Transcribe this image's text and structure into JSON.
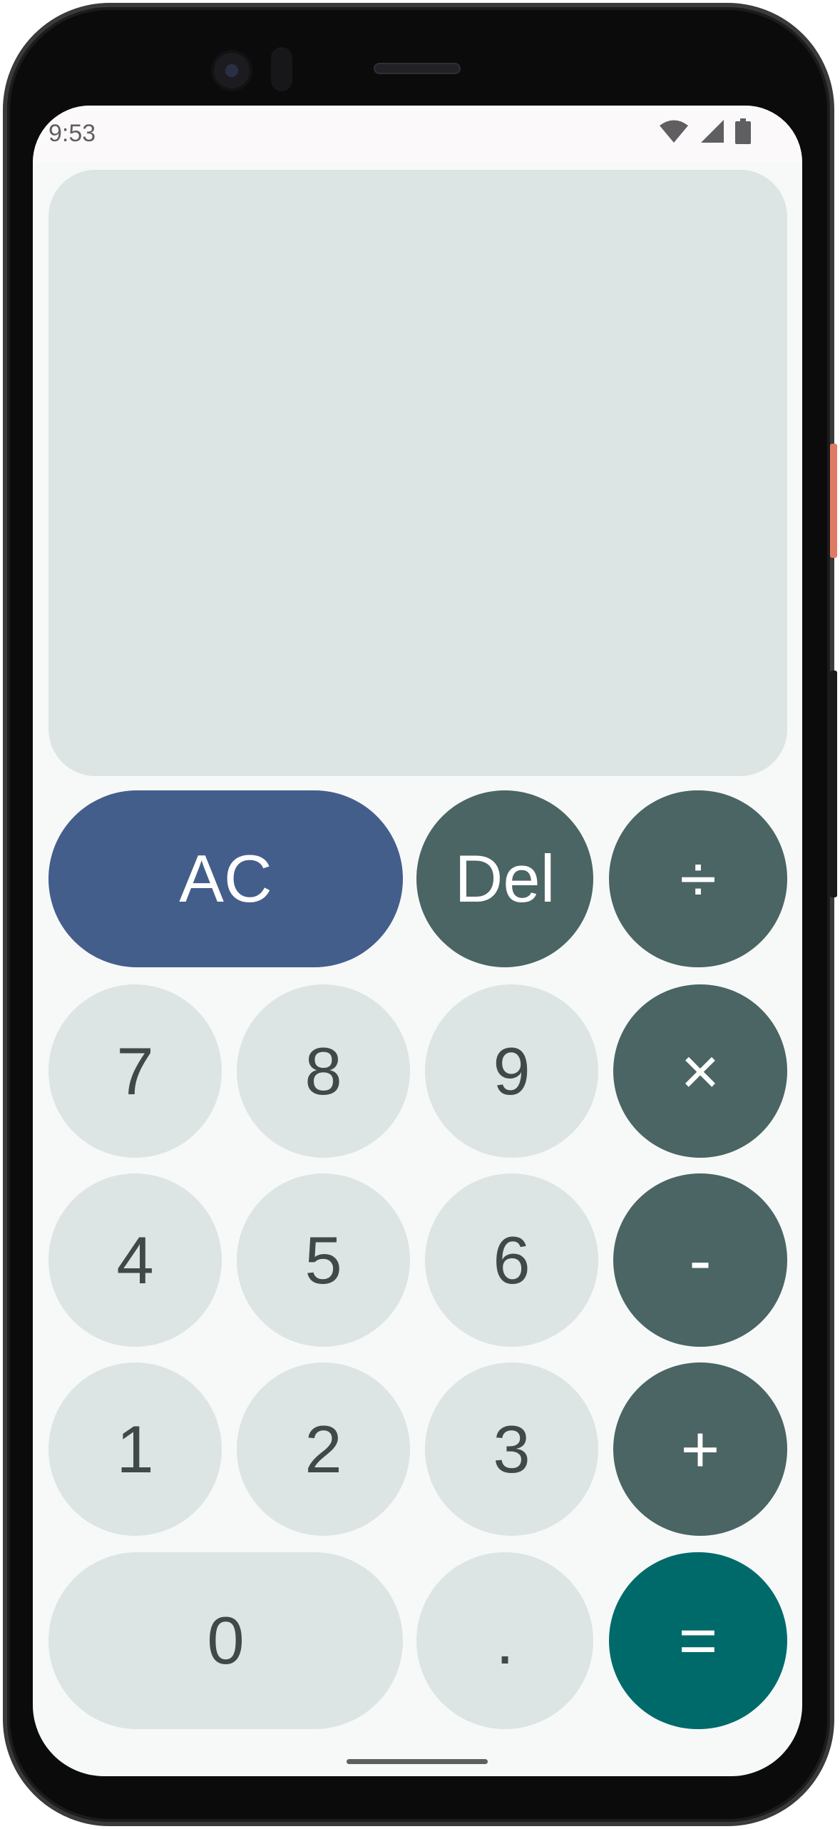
{
  "status_bar": {
    "time": "9:53",
    "icons": [
      "wifi-icon",
      "cell-signal-icon",
      "battery-icon"
    ]
  },
  "display": {
    "expression": "",
    "result": ""
  },
  "keys": {
    "clear": "AC",
    "delete": "Del",
    "divide": "÷",
    "multiply": "×",
    "subtract": "-",
    "add": "+",
    "equals": "=",
    "seven": "7",
    "eight": "8",
    "nine": "9",
    "four": "4",
    "five": "5",
    "six": "6",
    "one": "1",
    "two": "2",
    "three": "3",
    "zero": "0",
    "decimal": "."
  },
  "colors": {
    "operator": "#4a6563",
    "clear": "#435e8b",
    "equals": "#006a6b",
    "number": "#dce5e3",
    "number_text": "#3f4947"
  }
}
